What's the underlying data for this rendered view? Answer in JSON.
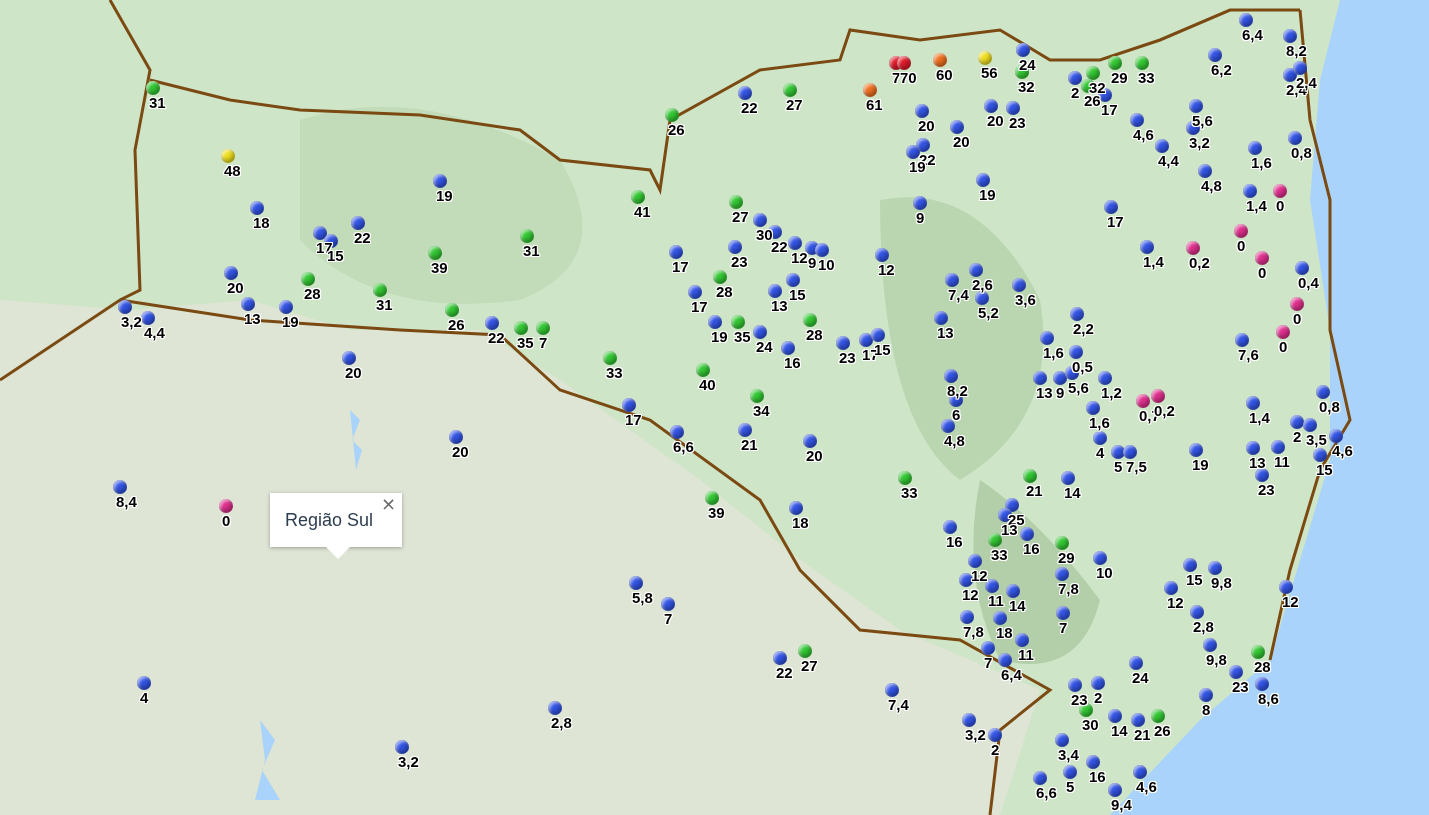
{
  "stations": [
    {
      "reading": "31",
      "color": "#33c833"
    },
    {
      "reading": "48",
      "color": "#f0e020"
    },
    {
      "reading": "18",
      "color": "#3355e6"
    },
    {
      "reading": "17",
      "color": "#3355e6"
    },
    {
      "reading": "15",
      "color": "#3355e6"
    },
    {
      "reading": "22",
      "color": "#3355e6"
    },
    {
      "reading": "19",
      "color": "#3355e6"
    },
    {
      "reading": "39",
      "color": "#33c833"
    },
    {
      "reading": "3,2",
      "color": "#3355e6"
    },
    {
      "reading": "4,4",
      "color": "#3355e6"
    },
    {
      "reading": "20",
      "color": "#3355e6"
    },
    {
      "reading": "13",
      "color": "#3355e6"
    },
    {
      "reading": "28",
      "color": "#33c833"
    },
    {
      "reading": "19",
      "color": "#3355e6"
    },
    {
      "reading": "31",
      "color": "#33c833"
    },
    {
      "reading": "26",
      "color": "#33c833"
    },
    {
      "reading": "20",
      "color": "#3355e6"
    },
    {
      "reading": "22",
      "color": "#3355e6"
    },
    {
      "reading": "35",
      "color": "#33c833"
    },
    {
      "reading": "7",
      "color": "#33c833"
    },
    {
      "reading": "26",
      "color": "#33c833"
    },
    {
      "reading": "22",
      "color": "#3355e6"
    },
    {
      "reading": "27",
      "color": "#33c833"
    },
    {
      "reading": "41",
      "color": "#33c833"
    },
    {
      "reading": "31",
      "color": "#33c833"
    },
    {
      "reading": "27",
      "color": "#33c833"
    },
    {
      "reading": "30",
      "color": "#3355e6"
    },
    {
      "reading": "22",
      "color": "#3355e6"
    },
    {
      "reading": "23",
      "color": "#3355e6"
    },
    {
      "reading": "17",
      "color": "#3355e6"
    },
    {
      "reading": "28",
      "color": "#33c833"
    },
    {
      "reading": "17",
      "color": "#3355e6"
    },
    {
      "reading": "19",
      "color": "#3355e6"
    },
    {
      "reading": "35",
      "color": "#33c833"
    },
    {
      "reading": "24",
      "color": "#3355e6"
    },
    {
      "reading": "12",
      "color": "#3355e6"
    },
    {
      "reading": "9",
      "color": "#3355e6"
    },
    {
      "reading": "10",
      "color": "#3355e6"
    },
    {
      "reading": "15",
      "color": "#3355e6"
    },
    {
      "reading": "13",
      "color": "#3355e6"
    },
    {
      "reading": "28",
      "color": "#33c833"
    },
    {
      "reading": "16",
      "color": "#3355e6"
    },
    {
      "reading": "12",
      "color": "#3355e6"
    },
    {
      "reading": "23",
      "color": "#3355e6"
    },
    {
      "reading": "17",
      "color": "#3355e6"
    },
    {
      "reading": "15",
      "color": "#3355e6"
    },
    {
      "reading": "9",
      "color": "#3355e6"
    },
    {
      "reading": "33",
      "color": "#33c833"
    },
    {
      "reading": "40",
      "color": "#33c833"
    },
    {
      "reading": "34",
      "color": "#33c833"
    },
    {
      "reading": "17",
      "color": "#3355e6"
    },
    {
      "reading": "6,6",
      "color": "#3355e6"
    },
    {
      "reading": "21",
      "color": "#3355e6"
    },
    {
      "reading": "20",
      "color": "#3355e6"
    },
    {
      "reading": "39",
      "color": "#33c833"
    },
    {
      "reading": "18",
      "color": "#3355e6"
    },
    {
      "reading": "33",
      "color": "#33c833"
    },
    {
      "reading": "5,8",
      "color": "#3355e6"
    },
    {
      "reading": "7",
      "color": "#3355e6"
    },
    {
      "reading": "22",
      "color": "#3355e6"
    },
    {
      "reading": "27",
      "color": "#33c833"
    },
    {
      "reading": "7,4",
      "color": "#3355e6"
    },
    {
      "reading": "2,8",
      "color": "#3355e6"
    },
    {
      "reading": "3,2",
      "color": "#3355e6"
    },
    {
      "reading": "4",
      "color": "#3355e6"
    },
    {
      "reading": "8,4",
      "color": "#3355e6"
    },
    {
      "reading": "0",
      "color": "#e0308e"
    },
    {
      "reading": "20",
      "color": "#3355e6"
    },
    {
      "reading": "7",
      "color": "#e01a2a"
    },
    {
      "reading": "70",
      "color": "#e01a2a"
    },
    {
      "reading": "60",
      "color": "#f07020"
    },
    {
      "reading": "61",
      "color": "#f07020"
    },
    {
      "reading": "56",
      "color": "#f0e020"
    },
    {
      "reading": "24",
      "color": "#3355e6"
    },
    {
      "reading": "32",
      "color": "#33c833"
    },
    {
      "reading": "20",
      "color": "#3355e6"
    },
    {
      "reading": "20",
      "color": "#3355e6"
    },
    {
      "reading": "22",
      "color": "#3355e6"
    },
    {
      "reading": "19",
      "color": "#3355e6"
    },
    {
      "reading": "20",
      "color": "#3355e6"
    },
    {
      "reading": "23",
      "color": "#3355e6"
    },
    {
      "reading": "19",
      "color": "#3355e6"
    },
    {
      "reading": "2",
      "color": "#3355e6"
    },
    {
      "reading": "32",
      "color": "#33c833"
    },
    {
      "reading": "26",
      "color": "#33c833"
    },
    {
      "reading": "17",
      "color": "#3355e6"
    },
    {
      "reading": "29",
      "color": "#33c833"
    },
    {
      "reading": "33",
      "color": "#33c833"
    },
    {
      "reading": "4,6",
      "color": "#3355e6"
    },
    {
      "reading": "4,4",
      "color": "#3355e6"
    },
    {
      "reading": "5,6",
      "color": "#3355e6"
    },
    {
      "reading": "3,2",
      "color": "#3355e6"
    },
    {
      "reading": "6,2",
      "color": "#3355e6"
    },
    {
      "reading": "6,4",
      "color": "#3355e6"
    },
    {
      "reading": "8,2",
      "color": "#3355e6"
    },
    {
      "reading": "2,4",
      "color": "#3355e6"
    },
    {
      "reading": "2,4",
      "color": "#3355e6"
    },
    {
      "reading": "0,8",
      "color": "#3355e6"
    },
    {
      "reading": "1,6",
      "color": "#3355e6"
    },
    {
      "reading": "4,8",
      "color": "#3355e6"
    },
    {
      "reading": "1,4",
      "color": "#3355e6"
    },
    {
      "reading": "0",
      "color": "#e0308e"
    },
    {
      "reading": "17",
      "color": "#3355e6"
    },
    {
      "reading": "1,4",
      "color": "#3355e6"
    },
    {
      "reading": "0,2",
      "color": "#e0308e"
    },
    {
      "reading": "0",
      "color": "#e0308e"
    },
    {
      "reading": "0",
      "color": "#e0308e"
    },
    {
      "reading": "0,4",
      "color": "#3355e6"
    },
    {
      "reading": "0",
      "color": "#e0308e"
    },
    {
      "reading": "0",
      "color": "#e0308e"
    },
    {
      "reading": "7,6",
      "color": "#3355e6"
    },
    {
      "reading": "2,6",
      "color": "#3355e6"
    },
    {
      "reading": "7,4",
      "color": "#3355e6"
    },
    {
      "reading": "5,2",
      "color": "#3355e6"
    },
    {
      "reading": "3,6",
      "color": "#3355e6"
    },
    {
      "reading": "2,2",
      "color": "#3355e6"
    },
    {
      "reading": "1,6",
      "color": "#3355e6"
    },
    {
      "reading": "0,5",
      "color": "#3355e6"
    },
    {
      "reading": "13",
      "color": "#3355e6"
    },
    {
      "reading": "9",
      "color": "#3355e6"
    },
    {
      "reading": "5,6",
      "color": "#3355e6"
    },
    {
      "reading": "1,2",
      "color": "#3355e6"
    },
    {
      "reading": "0,7",
      "color": "#e0308e"
    },
    {
      "reading": "0,2",
      "color": "#e0308e"
    },
    {
      "reading": "1,6",
      "color": "#3355e6"
    },
    {
      "reading": "4",
      "color": "#3355e6"
    },
    {
      "reading": "13",
      "color": "#3355e6"
    },
    {
      "reading": "8,2",
      "color": "#3355e6"
    },
    {
      "reading": "6",
      "color": "#3355e6"
    },
    {
      "reading": "4,8",
      "color": "#3355e6"
    },
    {
      "reading": "5",
      "color": "#3355e6"
    },
    {
      "reading": "7,5",
      "color": "#3355e6"
    },
    {
      "reading": "19",
      "color": "#3355e6"
    },
    {
      "reading": "1,4",
      "color": "#3355e6"
    },
    {
      "reading": "0,8",
      "color": "#3355e6"
    },
    {
      "reading": "2",
      "color": "#3355e6"
    },
    {
      "reading": "3,5",
      "color": "#3355e6"
    },
    {
      "reading": "4,6",
      "color": "#3355e6"
    },
    {
      "reading": "15",
      "color": "#3355e6"
    },
    {
      "reading": "13",
      "color": "#3355e6"
    },
    {
      "reading": "11",
      "color": "#3355e6"
    },
    {
      "reading": "21",
      "color": "#33c833"
    },
    {
      "reading": "14",
      "color": "#3355e6"
    },
    {
      "reading": "23",
      "color": "#3355e6"
    },
    {
      "reading": "25",
      "color": "#3355e6"
    },
    {
      "reading": "13",
      "color": "#3355e6"
    },
    {
      "reading": "16",
      "color": "#3355e6"
    },
    {
      "reading": "33",
      "color": "#33c833"
    },
    {
      "reading": "16",
      "color": "#3355e6"
    },
    {
      "reading": "29",
      "color": "#33c833"
    },
    {
      "reading": "12",
      "color": "#3355e6"
    },
    {
      "reading": "7,8",
      "color": "#3355e6"
    },
    {
      "reading": "10",
      "color": "#3355e6"
    },
    {
      "reading": "12",
      "color": "#3355e6"
    },
    {
      "reading": "11",
      "color": "#3355e6"
    },
    {
      "reading": "18",
      "color": "#3355e6"
    },
    {
      "reading": "14",
      "color": "#3355e6"
    },
    {
      "reading": "7,8",
      "color": "#3355e6"
    },
    {
      "reading": "7",
      "color": "#3355e6"
    },
    {
      "reading": "11",
      "color": "#3355e6"
    },
    {
      "reading": "6,4",
      "color": "#3355e6"
    },
    {
      "reading": "7",
      "color": "#3355e6"
    },
    {
      "reading": "15",
      "color": "#3355e6"
    },
    {
      "reading": "9,8",
      "color": "#3355e6"
    },
    {
      "reading": "12",
      "color": "#3355e6"
    },
    {
      "reading": "2,8",
      "color": "#3355e6"
    },
    {
      "reading": "9,8",
      "color": "#3355e6"
    },
    {
      "reading": "23",
      "color": "#3355e6"
    },
    {
      "reading": "28",
      "color": "#33c833"
    },
    {
      "reading": "12",
      "color": "#3355e6"
    },
    {
      "reading": "24",
      "color": "#3355e6"
    },
    {
      "reading": "23",
      "color": "#3355e6"
    },
    {
      "reading": "2",
      "color": "#3355e6"
    },
    {
      "reading": "30",
      "color": "#33c833"
    },
    {
      "reading": "14",
      "color": "#3355e6"
    },
    {
      "reading": "21",
      "color": "#3355e6"
    },
    {
      "reading": "26",
      "color": "#33c833"
    },
    {
      "reading": "8",
      "color": "#3355e6"
    },
    {
      "reading": "8,6",
      "color": "#3355e6"
    },
    {
      "reading": "3,2",
      "color": "#3355e6"
    },
    {
      "reading": "2",
      "color": "#3355e6"
    },
    {
      "reading": "3,4",
      "color": "#3355e6"
    },
    {
      "reading": "5",
      "color": "#3355e6"
    },
    {
      "reading": "16",
      "color": "#3355e6"
    },
    {
      "reading": "9,4",
      "color": "#3355e6"
    },
    {
      "reading": "4,6",
      "color": "#3355e6"
    },
    {
      "reading": "6,6",
      "color": "#3355e6"
    }
  ],
  "popup": {
    "title": "Região Sul",
    "close": "×"
  }
}
